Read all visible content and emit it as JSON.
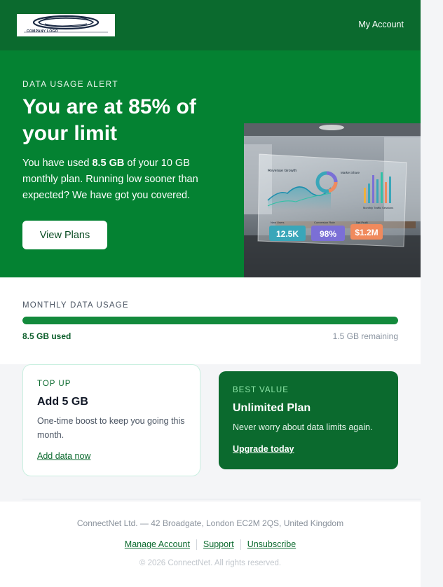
{
  "colors": {
    "brand_dark": "#0b6a2e",
    "brand": "#048232",
    "progress": "#138a3c",
    "best_value_accent": "#8ee6a8"
  },
  "header": {
    "logo_text": "COMPANY LOGO",
    "my_account": "My Account"
  },
  "hero": {
    "eyebrow": "DATA USAGE ALERT",
    "title": "You are at 85% of your limit",
    "body_pre": "You have used ",
    "body_bold": "8.5 GB",
    "body_post": " of your 10 GB monthly plan. Running low sooner than expected? We have got you covered.",
    "cta": "View Plans",
    "image": {
      "panel_title": "Revenue Growth",
      "donut_label": "Market Share",
      "bars_label": "Monthly Traffic Sessions",
      "kpis": [
        {
          "label": "New Users",
          "value": "12.5K",
          "color": "#3aa6b9"
        },
        {
          "label": "Conversion Rate",
          "value": "98%",
          "color": "#7b6fd6"
        },
        {
          "label": "Net Profit",
          "value": "$1.2M",
          "color": "#f08a5d"
        }
      ]
    }
  },
  "usage": {
    "label": "MONTHLY DATA USAGE",
    "fill_fraction": 1.0,
    "used_text": "8.5 GB used",
    "remaining_text": "1.5 GB remaining"
  },
  "cards": {
    "top_up": {
      "eyebrow": "TOP UP",
      "title": "Add 5 GB",
      "body": "One-time boost to keep you going this month.",
      "link": "Add data now"
    },
    "best_value": {
      "eyebrow": "BEST VALUE",
      "title": "Unlimited Plan",
      "body": "Never worry about data limits again.",
      "link": "Upgrade today"
    }
  },
  "footer": {
    "address": "ConnectNet Ltd. — 42 Broadgate, London EC2M 2QS, United Kingdom",
    "links": [
      "Manage Account",
      "Support",
      "Unsubscribe"
    ],
    "copyright": "© 2026 ConnectNet. All rights reserved."
  }
}
